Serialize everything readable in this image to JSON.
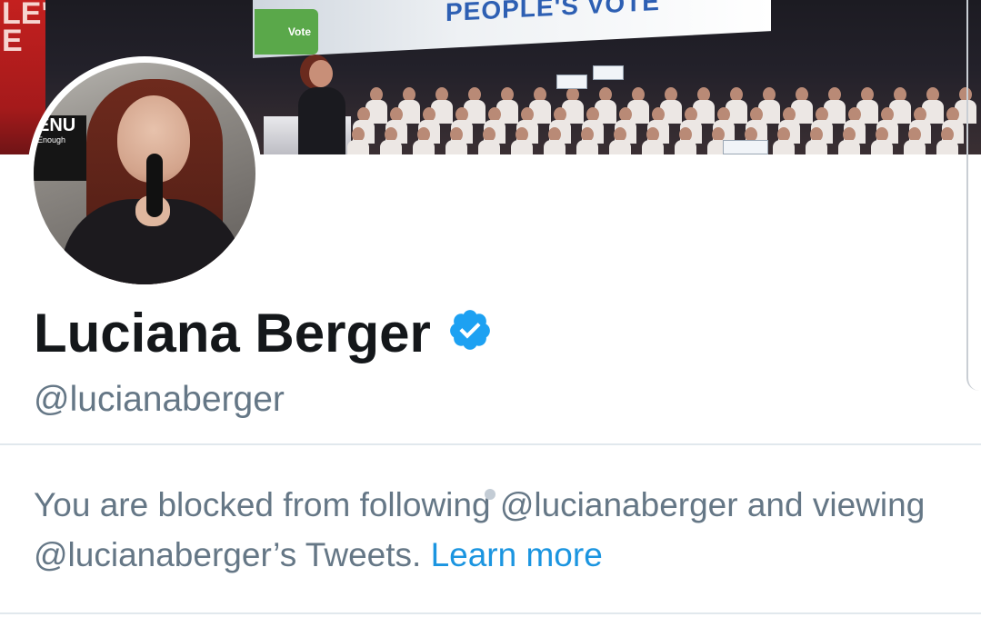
{
  "banner": {
    "side_sign_text": "LE'S\nE",
    "screen_headline": "PEOPLE'S VOTE",
    "screen_green_label": "Vote"
  },
  "avatar": {
    "sign_text": "ENU",
    "sign_subtext": "Enough"
  },
  "profile": {
    "display_name": "Luciana Berger",
    "handle": "@lucianaberger",
    "verified": true
  },
  "blocked_notice": {
    "message": "You are blocked from following @lucianaberger and viewing @lucianaberger’s Tweets. ",
    "learn_more_label": "Learn more"
  },
  "colors": {
    "name_text": "#14171a",
    "secondary_text": "#657786",
    "link_blue": "#1b95e0",
    "verified_blue": "#1da1f2",
    "divider": "#e1e8ed"
  }
}
